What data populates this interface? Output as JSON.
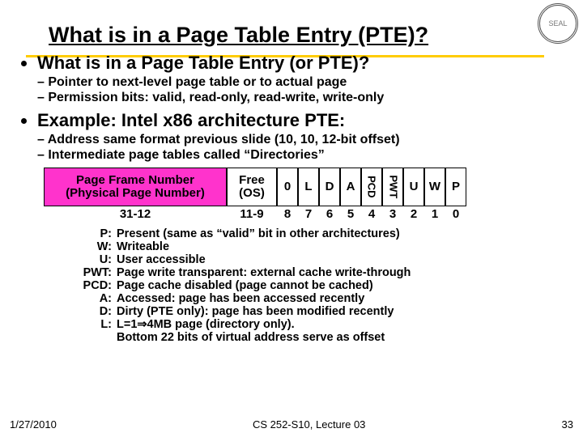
{
  "title": "What is in a Page Table Entry (PTE)?",
  "bullets": {
    "q": "What is in a Page Table Entry (or PTE)?",
    "q_sub": [
      "Pointer to next-level page table or to actual page",
      "Permission bits: valid, read-only, read-write, write-only"
    ],
    "ex": "Example: Intel x86 architecture PTE:",
    "ex_sub": [
      "Address same format previous slide (10, 10, 12-bit offset)",
      "Intermediate page tables called “Directories”"
    ]
  },
  "diagram": {
    "pfn_l1": "Page Frame Number",
    "pfn_l2": "(Physical Page Number)",
    "pfn_range": "31-12",
    "free_l1": "Free",
    "free_l2": "(OS)",
    "free_range": "11-9",
    "bits": [
      "0",
      "L",
      "D",
      "A",
      "PCD",
      "PWT",
      "U",
      "W",
      "P"
    ],
    "bitpos": [
      "8",
      "7",
      "6",
      "5",
      "4",
      "3",
      "2",
      "1",
      "0"
    ]
  },
  "defs": [
    {
      "k": "P:",
      "v": "Present (same as “valid” bit in other architectures)"
    },
    {
      "k": "W:",
      "v": "Writeable"
    },
    {
      "k": "U:",
      "v": "User accessible"
    },
    {
      "k": "PWT:",
      "v": "Page write transparent: external cache write-through"
    },
    {
      "k": "PCD:",
      "v": "Page cache disabled (page cannot be cached)"
    },
    {
      "k": "A:",
      "v": "Accessed: page has been accessed recently"
    },
    {
      "k": "D:",
      "v": "Dirty (PTE only): page has been modified recently"
    },
    {
      "k": "L:",
      "v": "L=1⇒4MB page (directory only)."
    },
    {
      "k": "",
      "v": "Bottom 22 bits of virtual address serve as offset"
    }
  ],
  "footer": {
    "date": "1/27/2010",
    "center": "CS 252-S10, Lecture 03",
    "page": "33"
  }
}
